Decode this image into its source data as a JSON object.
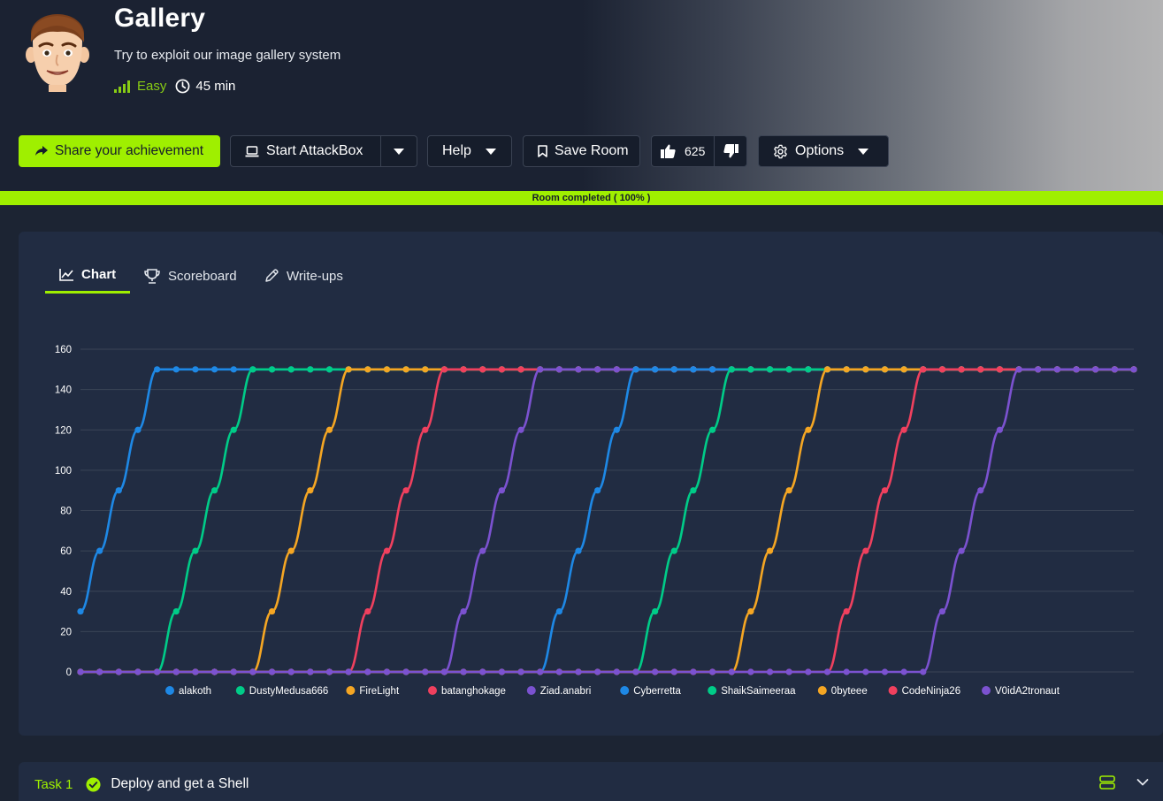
{
  "room": {
    "title": "Gallery",
    "subtitle": "Try to exploit our image gallery system",
    "difficulty": "Easy",
    "duration": "45 min",
    "avatar_icon": "cartoon-man-avatar"
  },
  "toolbar": {
    "share_label": "Share your achievement",
    "attackbox_label": "Start AttackBox",
    "help_label": "Help",
    "save_label": "Save Room",
    "likes": "625",
    "options_label": "Options"
  },
  "progress": {
    "label": "Room completed ( 100% )",
    "value": 100
  },
  "tabs": [
    {
      "label": "Chart",
      "icon": "line-chart-icon",
      "active": true
    },
    {
      "label": "Scoreboard",
      "icon": "trophy-icon",
      "active": false
    },
    {
      "label": "Write-ups",
      "icon": "pencil-icon",
      "active": false
    }
  ],
  "chart_data": {
    "type": "line",
    "title": "",
    "xlabel": "",
    "ylabel": "",
    "ylim": [
      0,
      160
    ],
    "yticks": [
      0,
      20,
      40,
      60,
      80,
      100,
      120,
      140,
      160
    ],
    "grid": true,
    "legend_position": "bottom",
    "series": [
      {
        "name": "alakoth",
        "color": "#1e88e5",
        "values": [
          30,
          60,
          90,
          120,
          150,
          150,
          150,
          150,
          150,
          150,
          150,
          150,
          150,
          150,
          150,
          150,
          150,
          150,
          150,
          150,
          150,
          150,
          150,
          150,
          150,
          150,
          150,
          150,
          150,
          150,
          150,
          150,
          150,
          150,
          150,
          150,
          150,
          150,
          150,
          150,
          150,
          150,
          150,
          150,
          150,
          150,
          150,
          150,
          150,
          150,
          150,
          150,
          150,
          150,
          150,
          150
        ]
      },
      {
        "name": "DustyMedusa666",
        "color": "#00cc88",
        "values": [
          0,
          0,
          0,
          0,
          0,
          30,
          60,
          90,
          120,
          150,
          150,
          150,
          150,
          150,
          150,
          150,
          150,
          150,
          150,
          150,
          150,
          150,
          150,
          150,
          150,
          150,
          150,
          150,
          150,
          150,
          150,
          150,
          150,
          150,
          150,
          150,
          150,
          150,
          150,
          150,
          150,
          150,
          150,
          150,
          150,
          150,
          150,
          150,
          150,
          150,
          150,
          150,
          150,
          150,
          150,
          150
        ]
      },
      {
        "name": "FireLight",
        "color": "#f5a623",
        "values": [
          0,
          0,
          0,
          0,
          0,
          0,
          0,
          0,
          0,
          0,
          30,
          60,
          90,
          120,
          150,
          150,
          150,
          150,
          150,
          150,
          150,
          150,
          150,
          150,
          150,
          150,
          150,
          150,
          150,
          150,
          150,
          150,
          150,
          150,
          150,
          150,
          150,
          150,
          150,
          150,
          150,
          150,
          150,
          150,
          150,
          150,
          150,
          150,
          150,
          150,
          150,
          150,
          150,
          150,
          150,
          150
        ]
      },
      {
        "name": "batanghokage",
        "color": "#f0405e",
        "values": [
          0,
          0,
          0,
          0,
          0,
          0,
          0,
          0,
          0,
          0,
          0,
          0,
          0,
          0,
          0,
          30,
          60,
          90,
          120,
          150,
          150,
          150,
          150,
          150,
          150,
          150,
          150,
          150,
          150,
          150,
          150,
          150,
          150,
          150,
          150,
          150,
          150,
          150,
          150,
          150,
          150,
          150,
          150,
          150,
          150,
          150,
          150,
          150,
          150,
          150,
          150,
          150,
          150,
          150,
          150,
          150
        ]
      },
      {
        "name": "Ziad.anabri",
        "color": "#7b52d0",
        "values": [
          0,
          0,
          0,
          0,
          0,
          0,
          0,
          0,
          0,
          0,
          0,
          0,
          0,
          0,
          0,
          0,
          0,
          0,
          0,
          0,
          30,
          60,
          90,
          120,
          150,
          150,
          150,
          150,
          150,
          150,
          150,
          150,
          150,
          150,
          150,
          150,
          150,
          150,
          150,
          150,
          150,
          150,
          150,
          150,
          150,
          150,
          150,
          150,
          150,
          150,
          150,
          150,
          150,
          150,
          150,
          150
        ]
      },
      {
        "name": "Cyberretta",
        "color": "#1e88e5",
        "values": [
          0,
          0,
          0,
          0,
          0,
          0,
          0,
          0,
          0,
          0,
          0,
          0,
          0,
          0,
          0,
          0,
          0,
          0,
          0,
          0,
          0,
          0,
          0,
          0,
          0,
          30,
          60,
          90,
          120,
          150,
          150,
          150,
          150,
          150,
          150,
          150,
          150,
          150,
          150,
          150,
          150,
          150,
          150,
          150,
          150,
          150,
          150,
          150,
          150,
          150,
          150,
          150,
          150,
          150,
          150,
          150
        ]
      },
      {
        "name": "ShaikSaimeeraa",
        "color": "#00cc88",
        "values": [
          0,
          0,
          0,
          0,
          0,
          0,
          0,
          0,
          0,
          0,
          0,
          0,
          0,
          0,
          0,
          0,
          0,
          0,
          0,
          0,
          0,
          0,
          0,
          0,
          0,
          0,
          0,
          0,
          0,
          0,
          30,
          60,
          90,
          120,
          150,
          150,
          150,
          150,
          150,
          150,
          150,
          150,
          150,
          150,
          150,
          150,
          150,
          150,
          150,
          150,
          150,
          150,
          150,
          150,
          150,
          150
        ]
      },
      {
        "name": "0byteee",
        "color": "#f5a623",
        "values": [
          0,
          0,
          0,
          0,
          0,
          0,
          0,
          0,
          0,
          0,
          0,
          0,
          0,
          0,
          0,
          0,
          0,
          0,
          0,
          0,
          0,
          0,
          0,
          0,
          0,
          0,
          0,
          0,
          0,
          0,
          0,
          0,
          0,
          0,
          0,
          30,
          60,
          90,
          120,
          150,
          150,
          150,
          150,
          150,
          150,
          150,
          150,
          150,
          150,
          150,
          150,
          150,
          150,
          150,
          150,
          150
        ]
      },
      {
        "name": "CodeNinja26",
        "color": "#f0405e",
        "values": [
          0,
          0,
          0,
          0,
          0,
          0,
          0,
          0,
          0,
          0,
          0,
          0,
          0,
          0,
          0,
          0,
          0,
          0,
          0,
          0,
          0,
          0,
          0,
          0,
          0,
          0,
          0,
          0,
          0,
          0,
          0,
          0,
          0,
          0,
          0,
          0,
          0,
          0,
          0,
          0,
          30,
          60,
          90,
          120,
          150,
          150,
          150,
          150,
          150,
          150,
          150,
          150,
          150,
          150,
          150,
          150
        ]
      },
      {
        "name": "V0idA2tronaut",
        "color": "#7b52d0",
        "values": [
          0,
          0,
          0,
          0,
          0,
          0,
          0,
          0,
          0,
          0,
          0,
          0,
          0,
          0,
          0,
          0,
          0,
          0,
          0,
          0,
          0,
          0,
          0,
          0,
          0,
          0,
          0,
          0,
          0,
          0,
          0,
          0,
          0,
          0,
          0,
          0,
          0,
          0,
          0,
          0,
          0,
          0,
          0,
          0,
          0,
          30,
          60,
          90,
          120,
          150,
          150,
          150,
          150,
          150,
          150,
          150
        ]
      }
    ]
  },
  "task": {
    "number": "Task 1",
    "title": "Deploy and get a Shell",
    "status_icon": "check-circle-icon"
  },
  "colors": {
    "accent": "#9fef00",
    "background": "#1c2433",
    "card": "#212c42"
  }
}
